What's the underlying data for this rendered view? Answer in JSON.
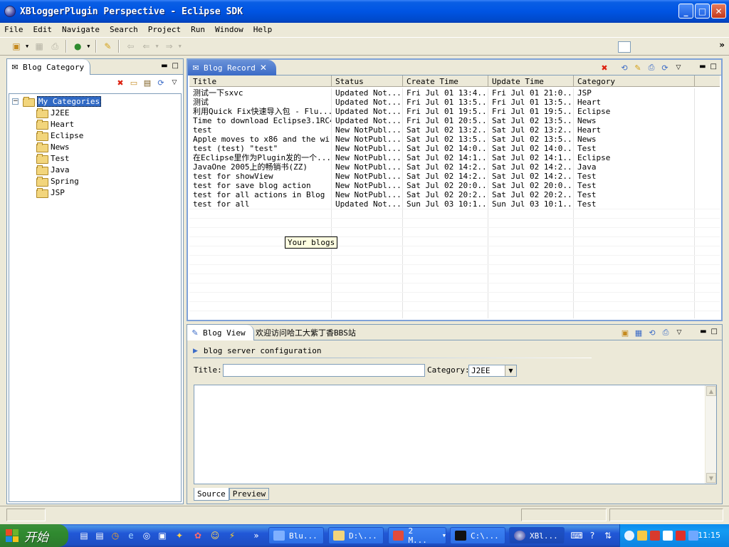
{
  "window": {
    "title": "XBloggerPlugin Perspective - Eclipse SDK",
    "controls": [
      "minimize",
      "maximize",
      "close"
    ]
  },
  "menubar": [
    "File",
    "Edit",
    "Navigate",
    "Search",
    "Project",
    "Run",
    "Window",
    "Help"
  ],
  "left_view": {
    "tab_label": "Blog Category",
    "tree": {
      "root": "My Categories",
      "children": [
        "J2EE",
        "Heart",
        "Eclipse",
        "News",
        "Test",
        "Java",
        "Spring",
        "JSP"
      ]
    }
  },
  "record_view": {
    "tab_label": "Blog Record",
    "columns": [
      "Title",
      "Status",
      "Create Time",
      "Update Time",
      "Category"
    ],
    "rows": [
      [
        "测试一下sxvc",
        "Updated Not...",
        "Fri Jul 01 13:4...",
        "Fri Jul 01 21:0...",
        "JSP"
      ],
      [
        "测试",
        "Updated Not...",
        "Fri Jul 01 13:5...",
        "Fri Jul 01 13:5...",
        "Heart"
      ],
      [
        "利用Quick Fix快速导入包 - Flu...",
        "Updated Not...",
        "Fri Jul 01 19:5...",
        "Fri Jul 01 19:5...",
        "Eclipse"
      ],
      [
        "Time to download Eclipse3.1RC4",
        "Updated Not...",
        "Fri Jul 01 20:5...",
        "Sat Jul 02 13:5...",
        "News"
      ],
      [
        "test",
        "New NotPubl...",
        "Sat Jul 02 13:2...",
        "Sat Jul 02 13:2...",
        "Heart"
      ],
      [
        "Apple moves to x86 and the wi...",
        "New NotPubl...",
        "Sat Jul 02 13:5...",
        "Sat Jul 02 13:5...",
        "News"
      ],
      [
        "test (test) \"test\"",
        "New NotPubl...",
        "Sat Jul 02 14:0...",
        "Sat Jul 02 14:0...",
        "Test"
      ],
      [
        "在Eclipse里作为Plugin发的一个...",
        "New NotPubl...",
        "Sat Jul 02 14:1...",
        "Sat Jul 02 14:1...",
        "Eclipse"
      ],
      [
        "JavaOne 2005上的畅销书(ZZ)",
        "New NotPubl...",
        "Sat Jul 02 14:2...",
        "Sat Jul 02 14:2...",
        "Java"
      ],
      [
        "test for showView",
        "New NotPubl...",
        "Sat Jul 02 14:2...",
        "Sat Jul 02 14:2...",
        "Test"
      ],
      [
        "test for save blog action",
        "New NotPubl...",
        "Sat Jul 02 20:0...",
        "Sat Jul 02 20:0...",
        "Test"
      ],
      [
        "test for all actions in Blog ...",
        "New NotPubl...",
        "Sat Jul 02 20:2...",
        "Sat Jul 02 20:2...",
        "Test"
      ],
      [
        "test for all",
        "Updated Not...",
        "Sun Jul 03 10:1...",
        "Sun Jul 03 10:1...",
        "Test"
      ]
    ],
    "tooltip": "Your blogs"
  },
  "blog_view": {
    "tab_label": "Blog View",
    "tab2_label": "欢迎访问哈工大紫丁香BBS站",
    "section_label": "blog server configuration",
    "title_label": "Title:",
    "title_value": "",
    "category_label": "Category:",
    "category_value": "J2EE",
    "bottom_tabs": [
      "Source",
      "Preview"
    ]
  },
  "taskbar": {
    "start_label": "开始",
    "tasks": [
      "Blu...",
      "D:\\...",
      "2 M...",
      "C:\\...",
      "XBl..."
    ],
    "clock": "11:15"
  }
}
